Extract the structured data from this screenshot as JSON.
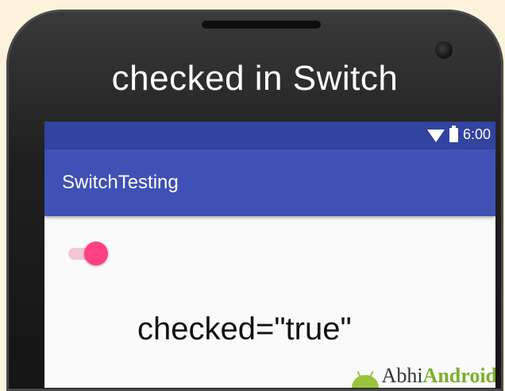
{
  "phone": {
    "title": "checked in Switch"
  },
  "status_bar": {
    "time": "6:00",
    "icons": [
      "wifi-icon",
      "battery-icon"
    ]
  },
  "app_bar": {
    "title": "SwitchTesting",
    "color": "#3f51b5",
    "status_color": "#3343a0"
  },
  "switch": {
    "checked": true,
    "thumb_color": "#ff4081",
    "track_color": "#f7c6d6"
  },
  "content": {
    "label": "checked=\"true\""
  },
  "watermark": {
    "part1": "Abhi",
    "part2": "Android"
  }
}
